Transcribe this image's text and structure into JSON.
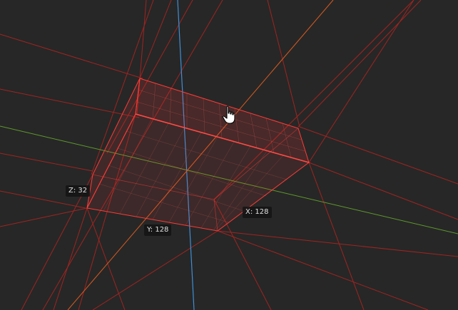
{
  "viewport": {
    "background": "#272727",
    "guide_line_color": "#c8231e",
    "selection_color": "#ff3b36",
    "axis_colors": {
      "vertical": "#3d8fd6",
      "horizontal": "#5e9a2a",
      "diagonal": "#d85a1f"
    }
  },
  "selection": {
    "x_label": "X: 128",
    "y_label": "Y: 128",
    "z_label": "Z: 32"
  },
  "cursor": {
    "icon": "hand-pointer-icon"
  }
}
